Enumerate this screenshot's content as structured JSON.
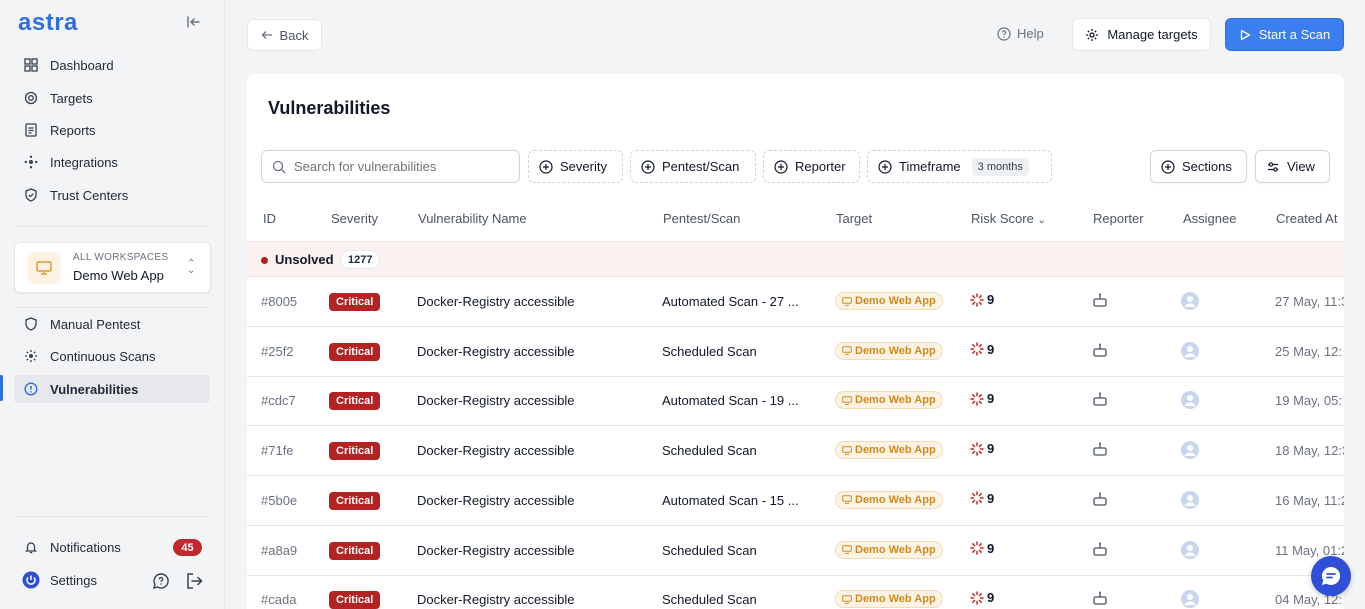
{
  "app": {
    "logo": "astra"
  },
  "sidebar": {
    "nav_top": [
      {
        "label": "Dashboard",
        "icon": "grid-icon"
      },
      {
        "label": "Targets",
        "icon": "target-icon"
      },
      {
        "label": "Reports",
        "icon": "report-icon"
      },
      {
        "label": "Integrations",
        "icon": "integrations-icon"
      },
      {
        "label": "Trust Centers",
        "icon": "shield-icon"
      }
    ],
    "workspace": {
      "label": "ALL WORKSPACES",
      "name": "Demo Web App"
    },
    "nav_mid": [
      {
        "label": "Manual Pentest",
        "icon": "shield-icon"
      },
      {
        "label": "Continuous Scans",
        "icon": "scan-icon"
      },
      {
        "label": "Vulnerabilities",
        "icon": "alert-circle-icon",
        "active": true
      }
    ],
    "notifications": {
      "label": "Notifications",
      "count": "45"
    },
    "settings": {
      "label": "Settings"
    }
  },
  "topbar": {
    "back_label": "Back",
    "help_label": "Help",
    "manage_label": "Manage targets",
    "start_label": "Start a Scan"
  },
  "panel": {
    "title": "Vulnerabilities",
    "search_placeholder": "Search for vulnerabilities",
    "filters": {
      "severity": "Severity",
      "pentest": "Pentest/Scan",
      "reporter": "Reporter",
      "timeframe": "Timeframe",
      "timeframe_value": "3 months"
    },
    "sections_label": "Sections",
    "view_label": "View"
  },
  "table": {
    "headers": {
      "id": "ID",
      "severity": "Severity",
      "name": "Vulnerability Name",
      "pentest": "Pentest/Scan",
      "target": "Target",
      "risk": "Risk Score",
      "reporter": "Reporter",
      "assignee": "Assignee",
      "created": "Created At"
    },
    "group": {
      "label": "Unsolved",
      "count": "1277"
    },
    "rows": [
      {
        "id": "#8005",
        "severity": "Critical",
        "name": "Docker-Registry accessible",
        "scan": "Automated Scan - 27 ...",
        "target": "Demo Web App",
        "risk": "9",
        "created": "27 May, 11:3"
      },
      {
        "id": "#25f2",
        "severity": "Critical",
        "name": "Docker-Registry accessible",
        "scan": "Scheduled Scan",
        "target": "Demo Web App",
        "risk": "9",
        "created": "25 May, 12:"
      },
      {
        "id": "#cdc7",
        "severity": "Critical",
        "name": "Docker-Registry accessible",
        "scan": "Automated Scan - 19 ...",
        "target": "Demo Web App",
        "risk": "9",
        "created": "19 May, 05:"
      },
      {
        "id": "#71fe",
        "severity": "Critical",
        "name": "Docker-Registry accessible",
        "scan": "Scheduled Scan",
        "target": "Demo Web App",
        "risk": "9",
        "created": "18 May, 12:3"
      },
      {
        "id": "#5b0e",
        "severity": "Critical",
        "name": "Docker-Registry accessible",
        "scan": "Automated Scan - 15 ...",
        "target": "Demo Web App",
        "risk": "9",
        "created": "16 May, 11:2"
      },
      {
        "id": "#a8a9",
        "severity": "Critical",
        "name": "Docker-Registry accessible",
        "scan": "Scheduled Scan",
        "target": "Demo Web App",
        "risk": "9",
        "created": "11 May, 01:2"
      },
      {
        "id": "#cada",
        "severity": "Critical",
        "name": "Docker-Registry accessible",
        "scan": "Scheduled Scan",
        "target": "Demo Web App",
        "risk": "9",
        "created": "04 May, 12:"
      }
    ]
  },
  "colors": {
    "accent": "#3a7ef0",
    "critical": "#b42323",
    "target_bg": "#fdf3e4",
    "target_text": "#d08a1f"
  }
}
